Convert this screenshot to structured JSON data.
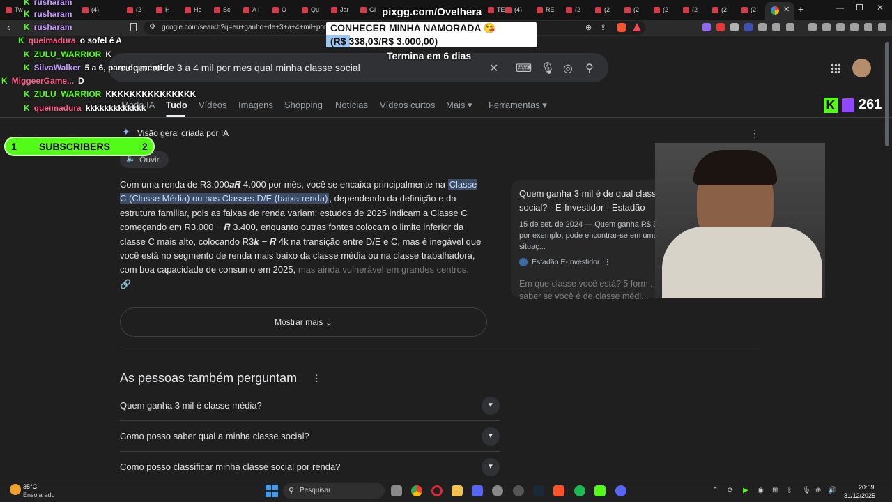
{
  "browser": {
    "tab_labels": [
      "Tw",
      "(4)",
      "(2",
      "H",
      "He",
      "Sc",
      "A I",
      "O",
      "Qu",
      "Jar",
      "Gi",
      "TE",
      "(4)",
      "RE",
      "(2",
      "(2",
      "(2",
      "(2",
      "(2",
      "(2",
      "(2"
    ],
    "url": "google.com/search?q=eu+ganho+de+3+a+4+mil+por+...s+qual+mi..."
  },
  "search": {
    "query": "eu ganho de 3 a 4 mil por mes qual minha classe social",
    "tabs": [
      "Modo IA",
      "Tudo",
      "Vídeos",
      "Imagens",
      "Shopping",
      "Notícias",
      "Vídeos curtos",
      "Mais ▾",
      "Ferramentas ▾"
    ]
  },
  "ai_overview": {
    "title": "Visão geral criada por IA",
    "listen_label": "Ouvir",
    "body_part1": "Com uma renda de R3.000𝒂𝑹 4.000 por mês, você se encaixa principalmente na ",
    "highlight": "Classe C (Classe Média) ou nas Classes D/E (baixa renda)",
    "body_part2": ", dependendo da definição e da estrutura familiar, pois as faixas de renda variam: estudos de 2025 indicam a Classe C começando em R3.000 − 𝑹 3.400, enquanto outras fontes colocam o limite inferior da classe C mais alto, colocando R3𝒌 − 𝑹 4k na transição entre D/E e C, mas é inegável que você está no segmento de renda mais baixo da classe média ou na classe trabalhadora, com boa capacidade de consumo em 2025, ",
    "body_fade": "mas ainda vulnerável em grandes centros.",
    "show_more": "Mostrar mais"
  },
  "source_card": {
    "title": "Quem ganha 3 mil é de qual classe social? - E-Investidor - Estadão",
    "snippet": "15 de set. de 2024 — Quem ganha R$ 3 mil, por exemplo, pode encontrar-se em uma situaç...",
    "site": "Estadão E-Investidor",
    "next_title": "Em que classe você está? 5 form... saber se você é de classe médi..."
  },
  "paa": {
    "title": "As pessoas também perguntam",
    "questions": [
      "Quem ganha 3 mil é classe média?",
      "Como posso saber qual a minha classe social?",
      "Como posso classificar minha classe social por renda?"
    ]
  },
  "overlay": {
    "pix_url": "pixgg.com/Ovelhera",
    "goal_title": "CONHECER MINHA NAMORADA 😘",
    "goal_amount": "(R$ 338,03/R$ 3.000,00)",
    "goal_progress": 0.113,
    "goal_timer": "Termina em 6 dias",
    "subs_left": "1",
    "subs_label": "SUBSCRIBERS",
    "subs_right": "2",
    "viewers": "261",
    "chat": [
      {
        "user": "rusharam",
        "msg": "",
        "color": "#c69cff"
      },
      {
        "user": "rusharam",
        "msg": "",
        "color": "#c69cff"
      },
      {
        "user": "rusharam",
        "msg": "",
        "color": "#c69cff"
      },
      {
        "user": "queimadura",
        "msg": "o sofel é A",
        "color": "#ff5c8a"
      },
      {
        "user": "ZULU_WARRIOR",
        "msg": "K",
        "color": "#53fc18"
      },
      {
        "user": "SilvaWalker",
        "msg": "5 a 6, pare de mentir",
        "color": "#c69cff"
      },
      {
        "user": "MiggeerGame...",
        "msg": "D",
        "color": "#ff5c8a"
      },
      {
        "user": "ZULU_WARRIOR",
        "msg": "KKKKKKKKKKKKKKK",
        "color": "#53fc18"
      },
      {
        "user": "queimadura",
        "msg": "kkkkkkkkkkkkk",
        "color": "#ff5c8a"
      }
    ]
  },
  "taskbar": {
    "temp": "35°C",
    "weather": "Ensolarado",
    "search_placeholder": "Pesquisar",
    "time": "20:59",
    "date": "31/12/2025"
  }
}
